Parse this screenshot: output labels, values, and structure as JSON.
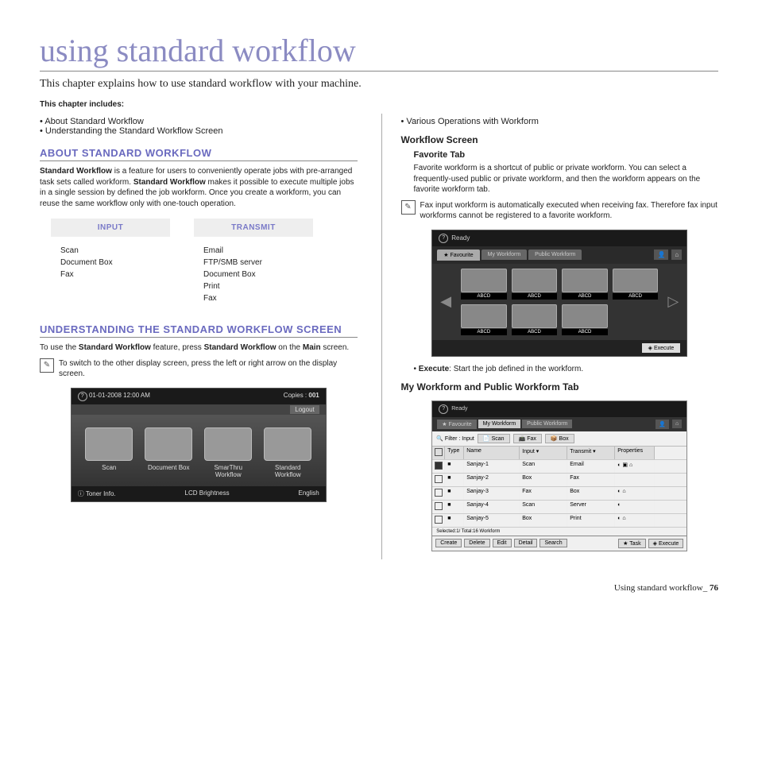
{
  "title": "using standard workflow",
  "intro": "This chapter explains how to use standard workflow with your machine.",
  "chapter_includes_label": "This chapter includes:",
  "toc_left": [
    "About Standard Workflow",
    "Understanding the Standard Workflow Screen"
  ],
  "toc_right": [
    "Various Operations with Workform"
  ],
  "about": {
    "heading": "ABOUT STANDARD WORKFLOW",
    "para_prefix": "Standard Workflow",
    "para_mid": " is a feature for users to conveniently operate jobs with pre-arranged task sets called workform. ",
    "para_bold2": "Standard Workflow",
    "para_mid2": " makes it possible to execute multiple jobs in a single session by defined the job workform. Once you create a workform, you can reuse the same workflow only with one-touch operation.",
    "input_label": "INPUT",
    "input_items": "Scan\nDocument Box\nFax",
    "transmit_label": "TRANSMIT",
    "transmit_items": "Email\nFTP/SMB server\nDocument Box\nPrint\nFax"
  },
  "understanding": {
    "heading": "UNDERSTANDING THE STANDARD WORKFLOW SCREEN",
    "para1a": "To use the ",
    "para1b": "Standard Workflow",
    "para1c": " feature, press ",
    "para1d": "Standard Workflow",
    "para1e": " on the ",
    "para1f": "Main",
    "para1g": " screen.",
    "note": "To switch to the other display screen, press the left or right arrow on the display screen."
  },
  "main_screen": {
    "datetime": "01-01-2008 12:00 AM",
    "copies_label": "Copies :",
    "copies_value": "001",
    "logout": "Logout",
    "icons": [
      "Scan",
      "Document Box",
      "SmarThru Workflow",
      "Standard Workflow"
    ],
    "toner": "Toner Info.",
    "lcd": "LCD Brightness",
    "lang": "English"
  },
  "workflow_screen": {
    "heading": "Workflow Screen",
    "fav_heading": "Favorite Tab",
    "fav_para": "Favorite workform is a shortcut of public or private workform. You can select a frequently-used public or private workform, and then the workform appears on the favorite workform tab.",
    "fav_note": "Fax input workform is automatically executed when receiving fax. Therefore fax input workforms cannot be registered to a favorite workform.",
    "ready": "Ready",
    "tabs": [
      "Favourite",
      "My Workform",
      "Public Workform"
    ],
    "item_label": "ABCD",
    "execute": "Execute",
    "exec_desc_bold": "Execute",
    "exec_desc": ": Start the job defined in the workform.",
    "my_heading": "My Workform and Public Workform Tab"
  },
  "my_screen": {
    "ready": "Ready",
    "tabs": [
      "Favourite",
      "My Workform",
      "Public Workform"
    ],
    "filter_label": "Filter : Input",
    "filters": [
      "Scan",
      "Fax",
      "Box"
    ],
    "cols": [
      "",
      "Type",
      "Name",
      "Input",
      "Transmit",
      "Properties"
    ],
    "rows": [
      {
        "chk": true,
        "type": "■",
        "name": "Sanjay-1",
        "input": "Scan",
        "transmit": "Email",
        "props": "◐ ▣ ⌂"
      },
      {
        "chk": false,
        "type": "■",
        "name": "Sanjay-2",
        "input": "Box",
        "transmit": "Fax",
        "props": ""
      },
      {
        "chk": false,
        "type": "■",
        "name": "Sanjay-3",
        "input": "Fax",
        "transmit": "Box",
        "props": "◐ ⌂"
      },
      {
        "chk": false,
        "type": "■",
        "name": "Sanjay-4",
        "input": "Scan",
        "transmit": "Server",
        "props": "◐"
      },
      {
        "chk": false,
        "type": "■",
        "name": "Sanjay-5",
        "input": "Box",
        "transmit": "Print",
        "props": "◐ ⌂"
      }
    ],
    "selected": "Selected:1/",
    "total": "Total:16 Workform",
    "buttons": [
      "Create",
      "Delete",
      "Edit",
      "Detail",
      "Search"
    ],
    "right_buttons": [
      "Task",
      "Execute"
    ]
  },
  "footer": {
    "text": "Using standard workflow_",
    "page": "76"
  }
}
